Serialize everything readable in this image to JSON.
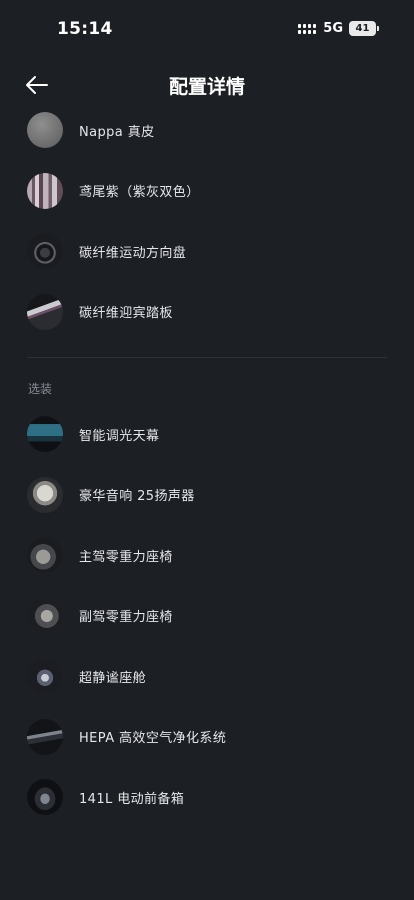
{
  "status_bar": {
    "time": "15:14",
    "network": "5G",
    "battery": "41"
  },
  "header": {
    "title": "配置详情",
    "back_icon": "arrow-left-icon"
  },
  "standard_items": [
    {
      "label": "Nappa 真皮",
      "icon": "nappa-leather-thumb"
    },
    {
      "label": "鸢尾紫（紫灰双色）",
      "icon": "iris-purple-thumb"
    },
    {
      "label": "碳纤维运动方向盘",
      "icon": "steering-wheel-thumb"
    },
    {
      "label": "碳纤维迎宾踏板",
      "icon": "door-sill-thumb"
    }
  ],
  "optional_section": {
    "label": "选装",
    "items": [
      {
        "label": "智能调光天幕",
        "icon": "panoramic-roof-thumb"
      },
      {
        "label": "豪华音响 25扬声器",
        "icon": "speaker-thumb"
      },
      {
        "label": "主驾零重力座椅",
        "icon": "driver-seat-thumb"
      },
      {
        "label": "副驾零重力座椅",
        "icon": "passenger-seat-thumb"
      },
      {
        "label": "超静谧座舱",
        "icon": "quiet-cabin-thumb"
      },
      {
        "label": "HEPA 高效空气净化系统",
        "icon": "air-filter-thumb"
      },
      {
        "label": "141L 电动前备箱",
        "icon": "frunk-thumb"
      }
    ]
  }
}
